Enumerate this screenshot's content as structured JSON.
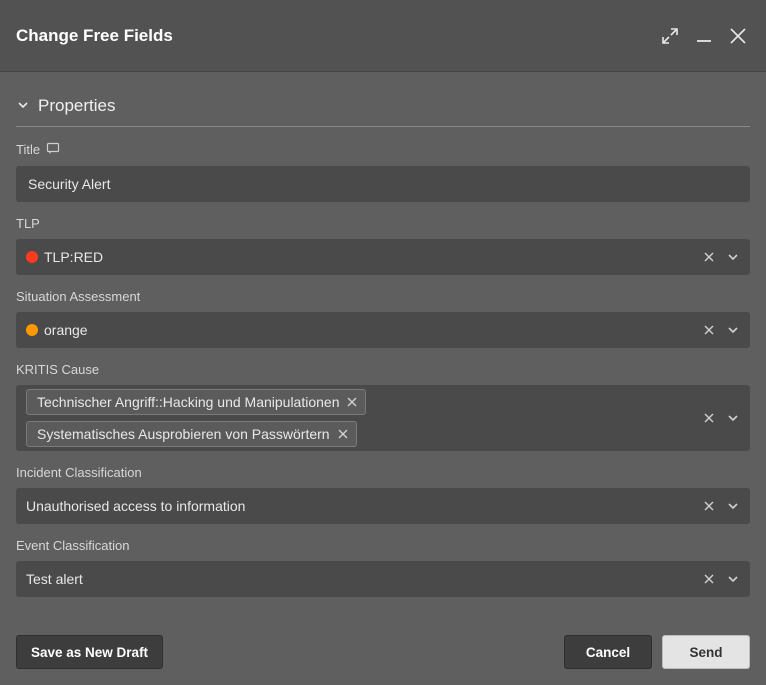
{
  "dialog": {
    "title": "Change Free Fields"
  },
  "section": {
    "title": "Properties"
  },
  "fields": {
    "title": {
      "label": "Title",
      "value": "Security Alert"
    },
    "tlp": {
      "label": "TLP",
      "value": "TLP:RED",
      "dot_color": "#ff3b1f"
    },
    "situation": {
      "label": "Situation Assessment",
      "value": "orange",
      "dot_color": "#ff9800"
    },
    "kritis": {
      "label": "KRITIS Cause",
      "tags": [
        "Technischer Angriff::Hacking und Manipulationen",
        "Systematisches Ausprobieren von Passwörtern"
      ]
    },
    "incident": {
      "label": "Incident Classification",
      "value": "Unauthorised access to information"
    },
    "event": {
      "label": "Event Classification",
      "value": "Test alert"
    }
  },
  "buttons": {
    "save_draft": "Save as New Draft",
    "cancel": "Cancel",
    "send": "Send"
  }
}
